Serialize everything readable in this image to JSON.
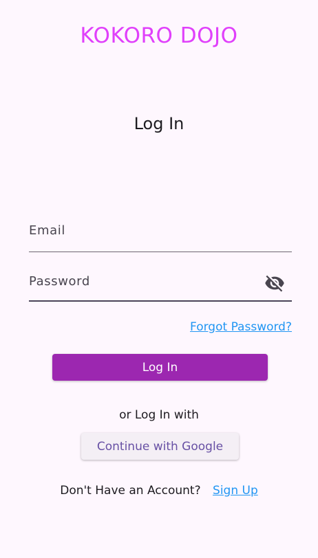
{
  "app": {
    "title": "KOKORO DOJO"
  },
  "login": {
    "page_title": "Log In",
    "email_placeholder": "Email",
    "password_placeholder": "Password",
    "forgot_password_label": "Forgot Password?",
    "login_button_label": "Log In",
    "or_text": "or Log In with",
    "google_button_label": "Continue with Google",
    "no_account_text": "Don't Have an Account?",
    "signup_label": "Sign Up"
  },
  "icons": {
    "password_visibility": "visibility-off-icon"
  },
  "colors": {
    "background": "#fef7fe",
    "app_title": "#e040fb",
    "primary_button": "#9c27b0",
    "link": "#2196f3",
    "google_button_text": "#6750a4"
  }
}
